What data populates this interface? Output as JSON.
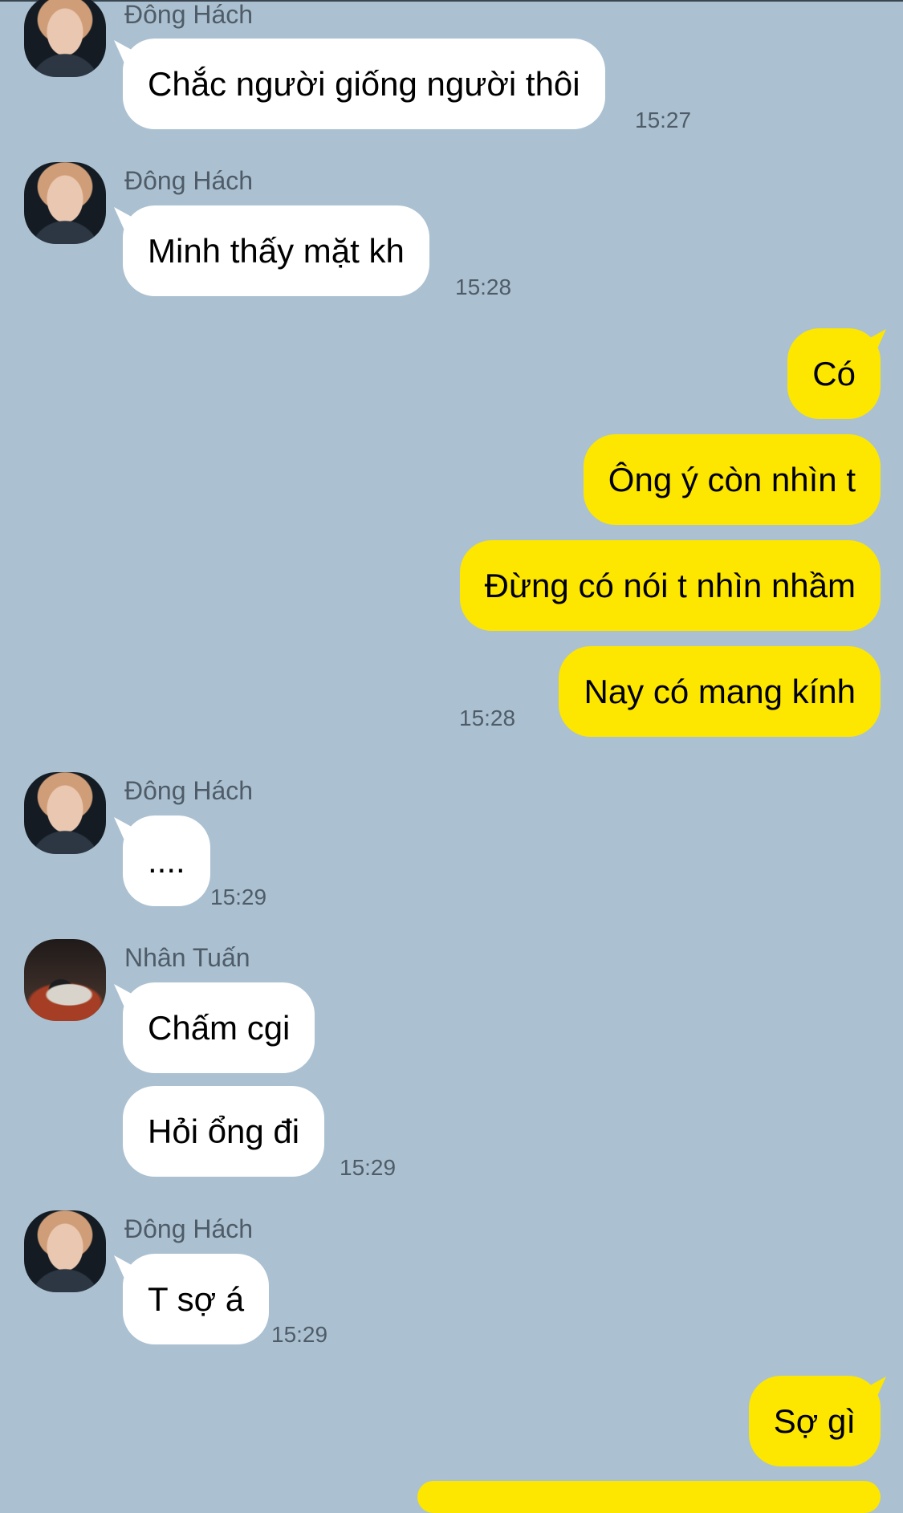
{
  "messages": [
    {
      "sender": "Đông Hách",
      "text": "Chắc người giống người thôi",
      "time": "15:27"
    },
    {
      "sender": "Đông Hách",
      "text": "Minh thấy mặt kh",
      "time": "15:28"
    },
    {
      "text": "Có"
    },
    {
      "text": "Ông ý còn nhìn t"
    },
    {
      "text": "Đừng có nói t nhìn nhầm"
    },
    {
      "text": "Nay có mang kính",
      "time": "15:28"
    },
    {
      "sender": "Đông Hách",
      "text": "....",
      "time": "15:29"
    },
    {
      "sender": "Nhân Tuấn",
      "text": "Chấm cgi"
    },
    {
      "text": "Hỏi ổng đi",
      "time": "15:29"
    },
    {
      "sender": "Đông Hách",
      "text": "T sợ á",
      "time": "15:29"
    },
    {
      "text": "Sợ gì"
    }
  ]
}
